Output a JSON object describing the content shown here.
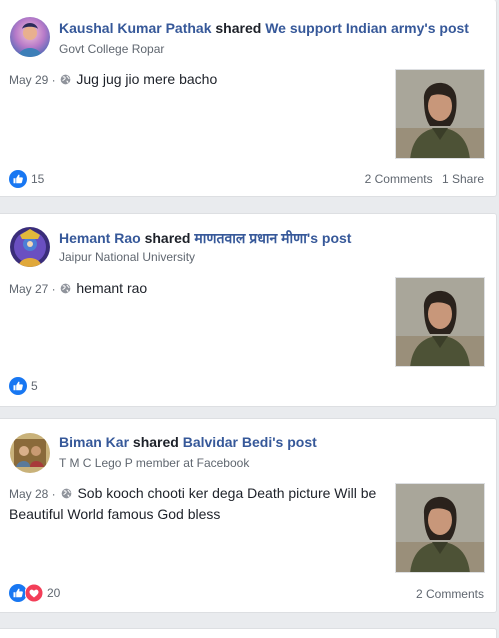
{
  "posts": [
    {
      "actor": "Kaushal Kumar Pathak",
      "verb": "shared",
      "target": "We support Indian army's post",
      "subtitle": "Govt College Ropar",
      "date": "May 29 ·",
      "text": "Jug jug jio mere bacho",
      "reaction_count": "15",
      "comments": "2 Comments",
      "shares": "1 Share"
    },
    {
      "actor": "Hemant Rao",
      "verb": "shared",
      "target": "माणतवाल प्रधान मीणा's post",
      "subtitle": "Jaipur National University",
      "date": "May 27 ·",
      "text": "hemant rao",
      "reaction_count": "5"
    },
    {
      "actor": "Biman Kar",
      "verb": "shared",
      "target": "Balvidar Bedi's post",
      "subtitle": "T M C Lego P member at Facebook",
      "date": "May 28 ·",
      "text": "Sob kooch chooti ker dega Death picture Will be Beautiful World famous God bless",
      "reaction_count": "20",
      "comments": "2 Comments"
    }
  ],
  "colors": {
    "link": "#365899",
    "meta": "#606770",
    "like_blue": "#1877f2",
    "love_red": "#f33e58",
    "background": "#e9ebee"
  },
  "icons": {
    "audience": "globe-icon",
    "like": "like-reaction-icon",
    "love": "love-reaction-icon"
  }
}
